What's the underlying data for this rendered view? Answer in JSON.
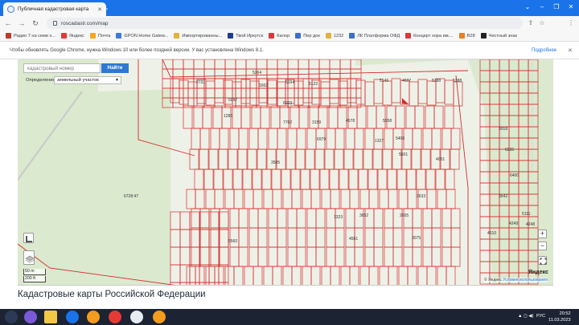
{
  "browser": {
    "tab_title": "Публичная кадастровая карта",
    "url": "roscadastr.com/map",
    "profile_initial": "M",
    "accent": "#1a73e8"
  },
  "bookmarks": [
    {
      "label": "Радио 7 на семи х...",
      "icon_color": "#c0392b"
    },
    {
      "label": "Яндекс",
      "icon_color": "#e53935"
    },
    {
      "label": "Почта",
      "icon_color": "#f5a623"
    },
    {
      "label": "GPON Home Gatew...",
      "icon_color": "#3f7bd9"
    },
    {
      "label": "Импортированны...",
      "icon_color": "#e2b23f"
    },
    {
      "label": "Твой Иркутск",
      "icon_color": "#1e3f8a"
    },
    {
      "label": "Калор",
      "icon_color": "#d83a3a"
    },
    {
      "label": "Пер док",
      "icon_color": "#3d6fcc"
    },
    {
      "label": "1232",
      "icon_color": "#e2b23f"
    },
    {
      "label": "ЛК Платформа ОФД",
      "icon_color": "#3d6fcc"
    },
    {
      "label": "Концерт хора им....",
      "icon_color": "#d83a3a"
    },
    {
      "label": "В28",
      "icon_color": "#e67e22"
    },
    {
      "label": "Честный знак",
      "icon_color": "#222222"
    }
  ],
  "infobar": {
    "message": "Чтобы обновлять Google Chrome, нужна Windows 10 или более поздней версии. У вас установлена Windows 8.1.",
    "link": "Подробнее"
  },
  "map": {
    "search_placeholder": "кадастровый номер",
    "search_button": "Найти",
    "definition_label": "Определение",
    "definition_value": "земельный участок",
    "scale_top": "50 m",
    "scale_bottom": "200 ft",
    "attribution": "© Яндекс",
    "terms_link": "Условия использования",
    "logo": "Яндекс",
    "zoom_in": "+",
    "zoom_out": "−",
    "labels": [
      "4607",
      "5388",
      "5146",
      "2731",
      "5097",
      "6023",
      "5194",
      "5122",
      "7762",
      "3159",
      "4578",
      "5558",
      "6979",
      "5406",
      "3595",
      "4051",
      "5601",
      "3633",
      "6728:47",
      "4561",
      "3075",
      "5560",
      "1323",
      "3652",
      "2605",
      "4610",
      "6400",
      "3542",
      "4249",
      "4248",
      "5111",
      "5388",
      "3018",
      "6235",
      "1327",
      "1286",
      "1662",
      "5264"
    ],
    "zoom_icon": "fullscreen"
  },
  "page": {
    "heading": "Кадастровые карты Российской Федерации"
  },
  "taskbar": {
    "lang": "РУС",
    "time": "20:52",
    "date": "11.03.2023"
  }
}
